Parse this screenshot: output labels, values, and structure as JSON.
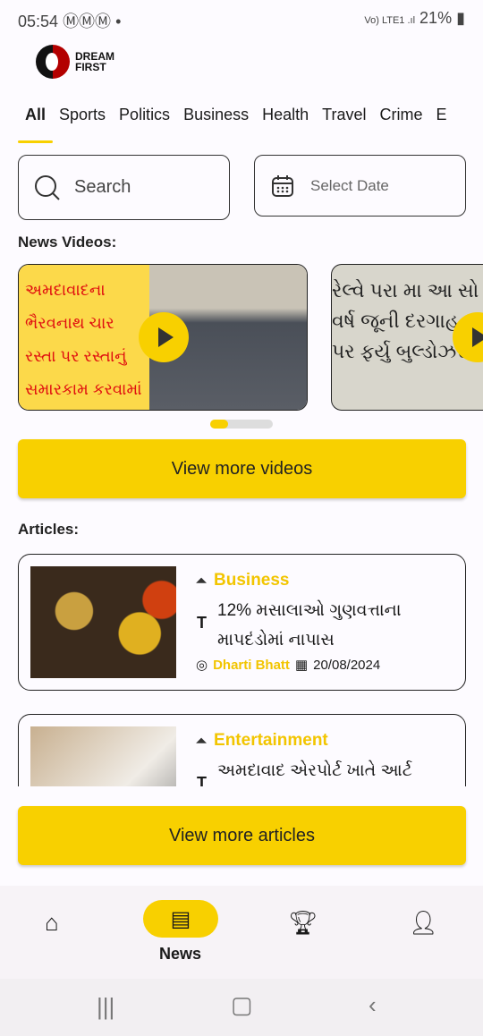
{
  "status": {
    "time": "05:54",
    "notifications": "ⓂⓂⓂ •",
    "signal": "Vo) LTE1 .ıl",
    "battery": "21%"
  },
  "logo": {
    "line1": "DREAM",
    "line2": "FIRST"
  },
  "tabs": [
    "All",
    "Sports",
    "Politics",
    "Business",
    "Health",
    "Travel",
    "Crime",
    "E"
  ],
  "search": {
    "placeholder": "Search"
  },
  "date": {
    "placeholder": "Select Date"
  },
  "videos": {
    "heading": "News Videos:",
    "items": [
      {
        "title": "અમદાવાદના ભૈરવનાથ ચાર રસ્તા પર રસ્તાનું સમારકામ કરવામાં આવ્યું"
      },
      {
        "title": "રેલ્વે પરા મા આ સો વર્ષ જૂની દરગાહ પર ફર્યુ બુલ્ડોઝર"
      }
    ],
    "more": "View more videos"
  },
  "articles": {
    "heading": "Articles:",
    "items": [
      {
        "category": "Business",
        "title": "12% મસાલાઓ ગુણવત્તાના માપદંડોમાં નાપાસ",
        "author": "Dharti Bhatt",
        "date": "20/08/2024"
      },
      {
        "category": "Entertainment",
        "title": "અમદાવાદ એરપોર્ટ ખાતે આર્ટ"
      }
    ],
    "more": "View more articles"
  },
  "nav": {
    "active": "News"
  },
  "colors": {
    "accent": "#f8d000",
    "brand_red": "#b30000"
  }
}
